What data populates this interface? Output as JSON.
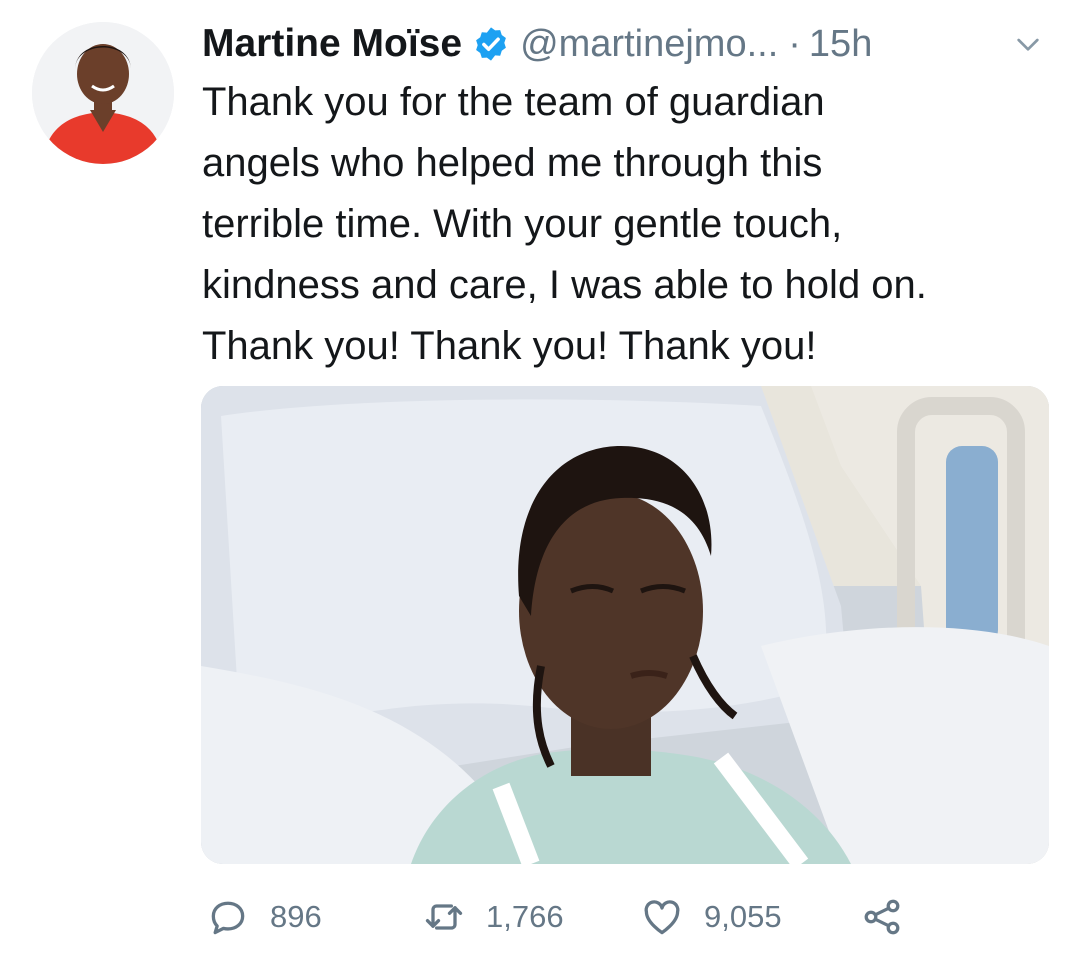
{
  "tweet": {
    "author_name": "Martine Moïse",
    "handle": "@martinejmo...",
    "separator": "·",
    "time": "15h",
    "text": "Thank you for the team of guardian\nangels who helped me through this\nterrible time. With your gentle touch,\nkindness and care, I was able to hold on.\nThank you! Thank you! Thank you!"
  },
  "actions": {
    "replies": "896",
    "retweets": "1,766",
    "likes": "9,055"
  },
  "colors": {
    "verified_badge": "#1da1f2",
    "secondary_text": "#657786",
    "primary_text": "#14171a"
  },
  "icons": [
    "verified-badge-icon",
    "chevron-down-icon",
    "reply-icon",
    "retweet-icon",
    "like-icon",
    "share-icon"
  ]
}
